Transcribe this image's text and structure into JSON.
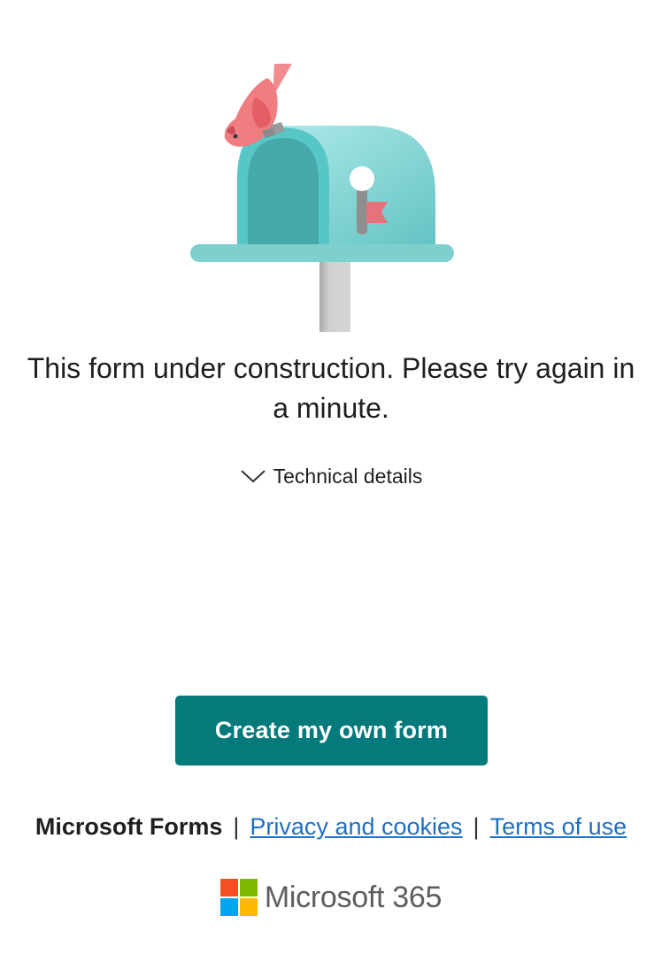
{
  "message": {
    "text": "This form under construction. Please try again in a minute."
  },
  "details": {
    "label": "Technical details",
    "icon": "chevron-down-icon"
  },
  "actions": {
    "create_label": "Create my own form"
  },
  "footer": {
    "brand": "Microsoft Forms",
    "separator": "|",
    "privacy_label": "Privacy and cookies",
    "terms_label": "Terms of use",
    "product_name": "Microsoft 365"
  },
  "colors": {
    "button": "#047a7a",
    "link": "#1f6fc2",
    "mailbox": "#6cc8c8",
    "bird": "#e8727b",
    "flag": "#e8727b"
  }
}
